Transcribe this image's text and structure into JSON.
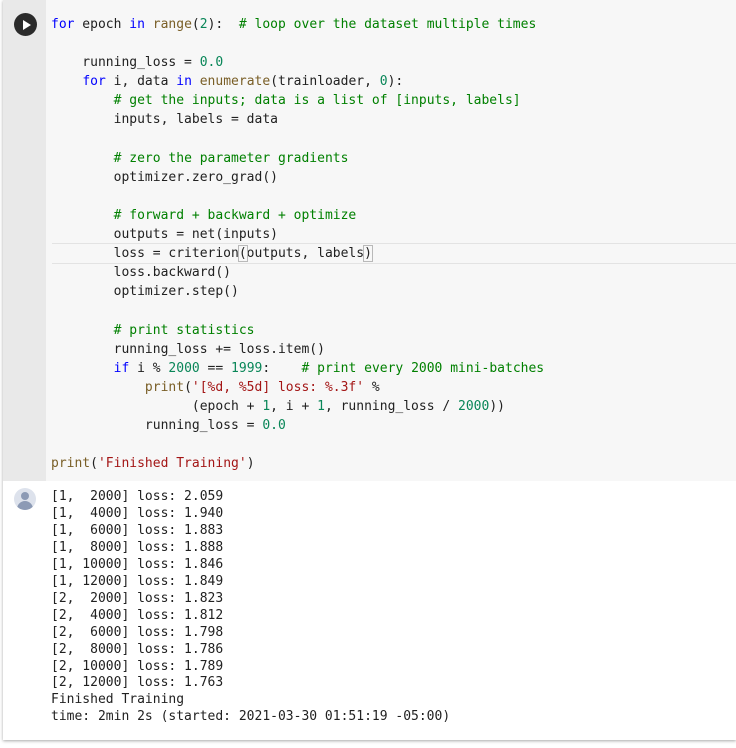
{
  "code_lines": [
    [
      {
        "t": "for",
        "c": "kw"
      },
      {
        "t": " epoch "
      },
      {
        "t": "in",
        "c": "kw"
      },
      {
        "t": " "
      },
      {
        "t": "range",
        "c": "bi"
      },
      {
        "t": "("
      },
      {
        "t": "2",
        "c": "num"
      },
      {
        "t": "):  "
      },
      {
        "t": "# loop over the dataset multiple times",
        "c": "com"
      }
    ],
    [],
    [
      {
        "t": "    running_loss = "
      },
      {
        "t": "0.0",
        "c": "num"
      }
    ],
    [
      {
        "t": "    "
      },
      {
        "t": "for",
        "c": "kw"
      },
      {
        "t": " i, data "
      },
      {
        "t": "in",
        "c": "kw"
      },
      {
        "t": " "
      },
      {
        "t": "enumerate",
        "c": "bi"
      },
      {
        "t": "(trainloader, "
      },
      {
        "t": "0",
        "c": "num"
      },
      {
        "t": "):"
      }
    ],
    [
      {
        "t": "        "
      },
      {
        "t": "# get the inputs; data is a list of [inputs, labels]",
        "c": "com"
      }
    ],
    [
      {
        "t": "        inputs, labels = data"
      }
    ],
    [],
    [
      {
        "t": "        "
      },
      {
        "t": "# zero the parameter gradients",
        "c": "com"
      }
    ],
    [
      {
        "t": "        optimizer.zero_grad()"
      }
    ],
    [],
    [
      {
        "t": "        "
      },
      {
        "t": "# forward + backward + optimize",
        "c": "com"
      }
    ],
    [
      {
        "t": "        outputs = net(inputs)"
      }
    ],
    [
      {
        "t": "        loss = criterion"
      },
      {
        "t": "(",
        "c": "bracket"
      },
      {
        "t": "outputs, labels"
      },
      {
        "t": ")",
        "c": "bracket"
      },
      {
        "t": "",
        "c": "cursor"
      }
    ],
    [
      {
        "t": "        loss.backward()"
      }
    ],
    [
      {
        "t": "        optimizer.step()"
      }
    ],
    [],
    [
      {
        "t": "        "
      },
      {
        "t": "# print statistics",
        "c": "com"
      }
    ],
    [
      {
        "t": "        running_loss += loss.item()"
      }
    ],
    [
      {
        "t": "        "
      },
      {
        "t": "if",
        "c": "kw"
      },
      {
        "t": " i % "
      },
      {
        "t": "2000",
        "c": "num"
      },
      {
        "t": " == "
      },
      {
        "t": "1999",
        "c": "num"
      },
      {
        "t": ":    "
      },
      {
        "t": "# print every 2000 mini-batches",
        "c": "com"
      }
    ],
    [
      {
        "t": "            "
      },
      {
        "t": "print",
        "c": "bi"
      },
      {
        "t": "("
      },
      {
        "t": "'[%d, %5d] loss: %.3f'",
        "c": "str"
      },
      {
        "t": " %"
      }
    ],
    [
      {
        "t": "                  (epoch + "
      },
      {
        "t": "1",
        "c": "num"
      },
      {
        "t": ", i + "
      },
      {
        "t": "1",
        "c": "num"
      },
      {
        "t": ", running_loss / "
      },
      {
        "t": "2000",
        "c": "num"
      },
      {
        "t": "))"
      }
    ],
    [
      {
        "t": "            running_loss = "
      },
      {
        "t": "0.0",
        "c": "num"
      }
    ],
    [],
    [
      {
        "t": "print",
        "c": "bi"
      },
      {
        "t": "("
      },
      {
        "t": "'Finished Training'",
        "c": "str"
      },
      {
        "t": ")"
      }
    ]
  ],
  "output_lines": [
    "[1,  2000] loss: 2.059",
    "[1,  4000] loss: 1.940",
    "[1,  6000] loss: 1.883",
    "[1,  8000] loss: 1.888",
    "[1, 10000] loss: 1.846",
    "[1, 12000] loss: 1.849",
    "[2,  2000] loss: 1.823",
    "[2,  4000] loss: 1.812",
    "[2,  6000] loss: 1.798",
    "[2,  8000] loss: 1.786",
    "[2, 10000] loss: 1.789",
    "[2, 12000] loss: 1.763",
    "Finished Training",
    "time: 2min 2s (started: 2021-03-30 01:51:19 -05:00)"
  ],
  "icons": {
    "run": "play-icon",
    "output": "user-avatar-icon"
  }
}
